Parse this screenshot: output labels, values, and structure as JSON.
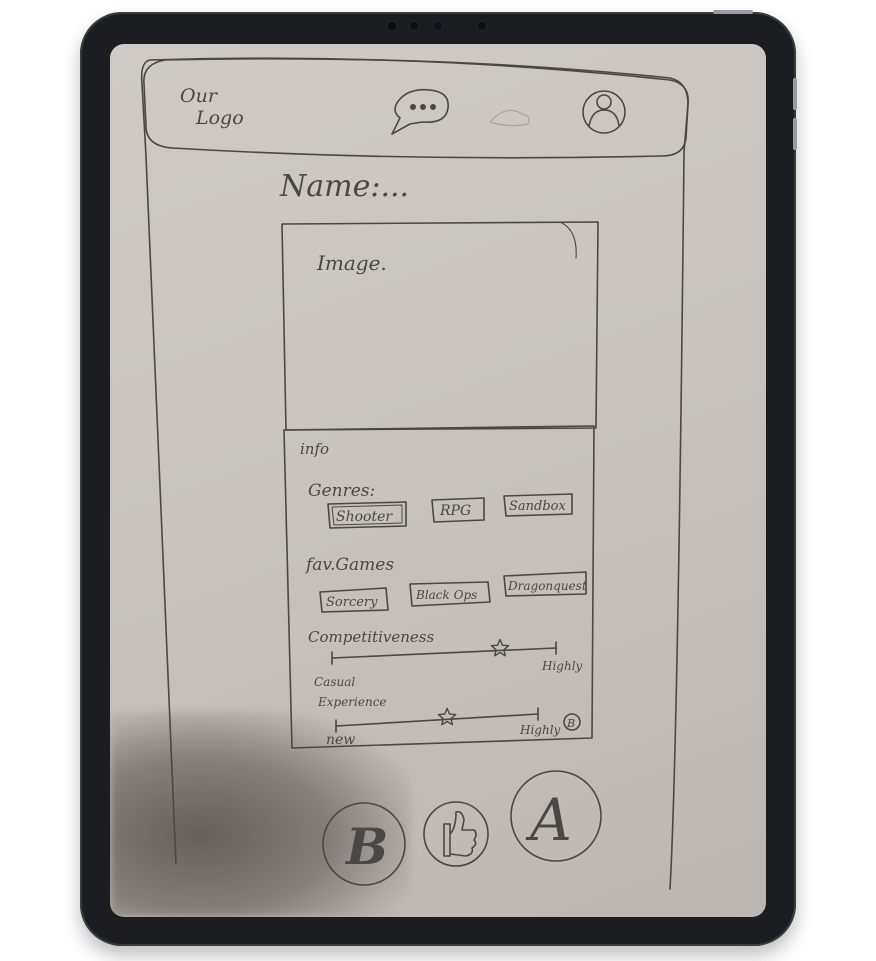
{
  "header": {
    "logo_line1": "Our",
    "logo_line2": "Logo",
    "chat_icon": "chat-bubble-icon",
    "profile_icon": "user-icon"
  },
  "profile": {
    "name_label": "Name:..."
  },
  "image_box": {
    "label": "Image."
  },
  "info": {
    "title": "info",
    "genres_label": "Genres:",
    "genres": [
      "Shooter",
      "RPG",
      "Sandbox"
    ],
    "fav_games_label": "fav.Games",
    "fav_games": [
      "Sorcery",
      "Black Ops",
      "Dragonquest"
    ],
    "competitiveness": {
      "label": "Competitiveness",
      "min_label": "Casual",
      "max_label": "Highly",
      "level": 0.75
    },
    "experience": {
      "label": "Experience",
      "min_label": "new",
      "max_label": "Highly",
      "level": 0.55
    },
    "corner_badge": "B"
  },
  "actions": [
    {
      "label": "B"
    },
    {
      "label": "thumbs-up-icon"
    },
    {
      "label": "A"
    }
  ],
  "colors": {
    "pencil": "#4a4744",
    "paper": "#cbc6c2",
    "bezel": "#1c1d21"
  }
}
